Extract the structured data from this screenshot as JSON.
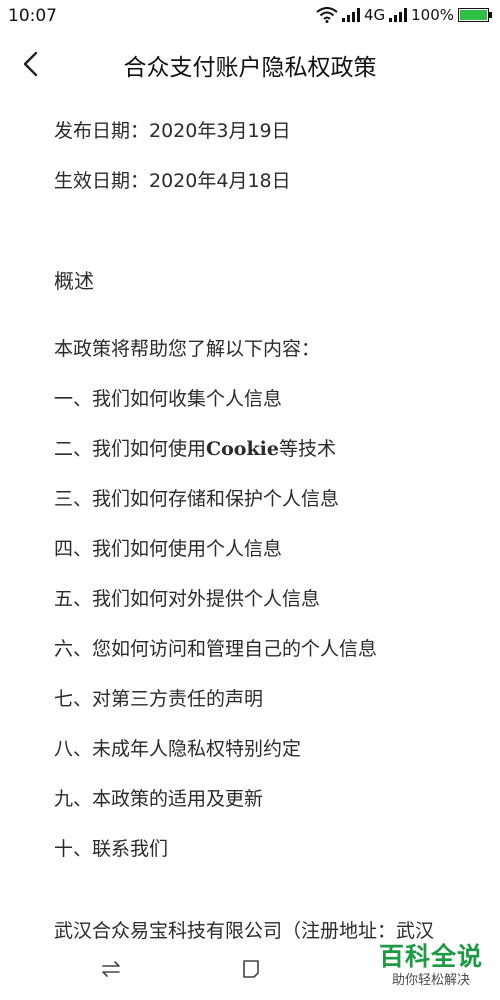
{
  "status_bar": {
    "time": "10:07",
    "network": "4G",
    "battery": "100%",
    "icons": [
      "wifi-icon",
      "signal-icon",
      "battery-icon"
    ]
  },
  "header": {
    "title": "合众支付账户隐私权政策",
    "back_icon": "chevron-left-icon"
  },
  "content": {
    "publish_date": "发布日期：2020年3月19日",
    "effective_date": "生效日期：2020年4月18日",
    "section_heading": "概述",
    "intro": "本政策将帮助您了解以下内容：",
    "items": [
      {
        "prefix": "一、我们如何收集个人信息",
        "bold": "",
        "suffix": ""
      },
      {
        "prefix": "二、我们如何使用",
        "bold": "Cookie",
        "suffix": "等技术"
      },
      {
        "prefix": "三、我们如何存储和保护个人信息",
        "bold": "",
        "suffix": ""
      },
      {
        "prefix": "四、我们如何使用个人信息",
        "bold": "",
        "suffix": ""
      },
      {
        "prefix": "五、我们如何对外提供个人信息",
        "bold": "",
        "suffix": ""
      },
      {
        "prefix": "六、您如何访问和管理自己的个人信息",
        "bold": "",
        "suffix": ""
      },
      {
        "prefix": "七、对第三方责任的声明",
        "bold": "",
        "suffix": ""
      },
      {
        "prefix": "八、未成年人隐私权特别约定",
        "bold": "",
        "suffix": ""
      },
      {
        "prefix": "九、本政策的适用及更新",
        "bold": "",
        "suffix": ""
      },
      {
        "prefix": "十、联系我们",
        "bold": "",
        "suffix": ""
      }
    ],
    "cutoff_text": "武汉合众易宝科技有限公司（注册地址：武汉"
  },
  "nav_bar": {
    "icons": [
      "menu-icon",
      "home-icon"
    ]
  },
  "watermark": {
    "title": "百科全说",
    "subtitle": "助你轻松解决"
  },
  "colors": {
    "battery": "#2fbf45",
    "watermark": "#1d9a44"
  }
}
